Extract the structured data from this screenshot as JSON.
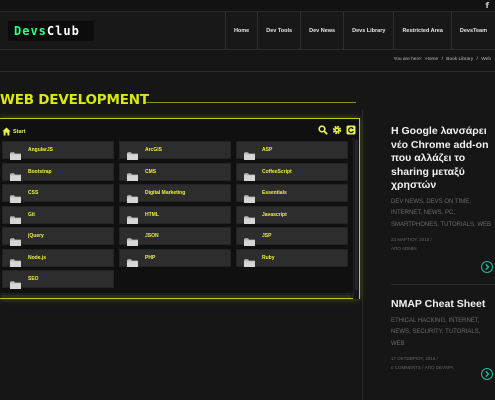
{
  "topbar": {
    "social_icon": "facebook-icon",
    "social_glyph": "f"
  },
  "brand": {
    "part_a": "Devs",
    "part_b": "Club",
    "color_a": "#2cff86",
    "color_b": "#ffffff"
  },
  "nav": [
    {
      "label": "Home"
    },
    {
      "label": "Dev Tools"
    },
    {
      "label": "Dev News"
    },
    {
      "label": "Devs Library"
    },
    {
      "label": "Restricted Area"
    },
    {
      "label": "DevsTeam"
    }
  ],
  "breadcrumb": {
    "prefix": "You are here:",
    "items": [
      "Home",
      "Book Library",
      "Web"
    ],
    "separator": "/"
  },
  "page_title": "WEB DEVELOPMENT",
  "accent_color": "#d8e810",
  "library": {
    "home_label": "Start",
    "tool_icons": [
      "search-icon",
      "gear-icon",
      "refresh-icon"
    ],
    "folders": [
      [
        "AngularJS",
        "ArcGIS",
        "ASP"
      ],
      [
        "Bootstrap",
        "CMS",
        "CoffeeScript"
      ],
      [
        "CSS",
        "Digital Marketing",
        "Essentials"
      ],
      [
        "Git",
        "HTML",
        "Javascript"
      ],
      [
        "jQuery",
        "JSON",
        "JSP"
      ],
      [
        "Node.js",
        "PHP",
        "Ruby"
      ],
      [
        "SEO"
      ]
    ]
  },
  "sidebar": {
    "posts": [
      {
        "title": "Η Google λανσάρει νέο Chrome add-on που αλλάζει το sharing μεταξύ χρηστών",
        "categories": "DEV NEWS, DEVS ON TIME, INTERNET, NEWS, PC, SMARTPHONES, TUTORIALS, WEB",
        "meta_date": "23 ΜΑΡΤΙΟΥ, 2015",
        "meta_sep": "/",
        "meta_author": "ΑΠΟ ADMIN"
      },
      {
        "title": "NMAP Cheat Sheet",
        "categories": "ETHICAL HACKING, INTERNET, NEWS, SECURITY, TUTORIALS, WEB",
        "meta_date": "17 ΟΚΤΩΒΡΙΟΥ, 2016",
        "meta_sep": "/",
        "meta_author": "0 COMMENTS / ΑΠΟ DEVSPA"
      }
    ]
  }
}
